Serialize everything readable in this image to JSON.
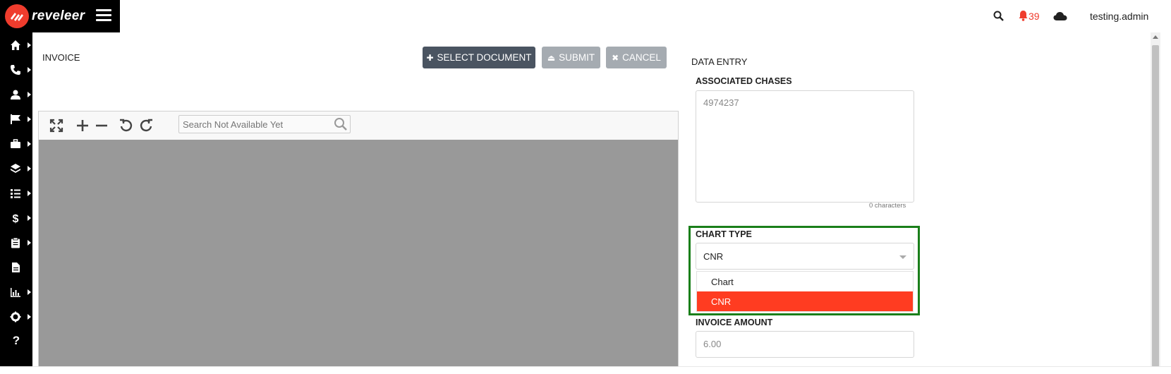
{
  "brand": {
    "name": "reveleer"
  },
  "topbar": {
    "notification_count": "39",
    "username": "testing.admin"
  },
  "sidebar": {
    "items": [
      {
        "icon": "home-icon"
      },
      {
        "icon": "phone-icon"
      },
      {
        "icon": "user-icon"
      },
      {
        "icon": "flag-icon"
      },
      {
        "icon": "briefcase-icon"
      },
      {
        "icon": "layers-icon"
      },
      {
        "icon": "tasks-icon"
      },
      {
        "icon": "dollar-icon"
      },
      {
        "icon": "clipboard-icon"
      },
      {
        "icon": "document-icon"
      },
      {
        "icon": "bar-chart-icon"
      },
      {
        "icon": "gear-icon"
      }
    ],
    "help_label": "?"
  },
  "invoice": {
    "title": "INVOICE",
    "select_document_label": "SELECT DOCUMENT",
    "submit_label": "SUBMIT",
    "cancel_label": "CANCEL"
  },
  "viewer": {
    "search_placeholder": "Search Not Available Yet"
  },
  "data_entry": {
    "title": "DATA ENTRY",
    "associated_chases_label": "ASSOCIATED CHASES",
    "associated_chases_value": "4974237",
    "char_count": "0 characters",
    "chart_type_label": "CHART TYPE",
    "chart_type_value": "CNR",
    "chart_type_options": [
      "Chart",
      "CNR"
    ],
    "chart_type_selected_option": "CNR",
    "invoice_amount_label": "INVOICE AMOUNT",
    "invoice_amount_value": "6.00"
  },
  "colors": {
    "brand_red": "#ef3c2d",
    "dark_button": "#4a5461",
    "disabled_button": "#a5abb1",
    "highlight_green": "#1a7f1a",
    "selected_option": "#ff3c21"
  }
}
